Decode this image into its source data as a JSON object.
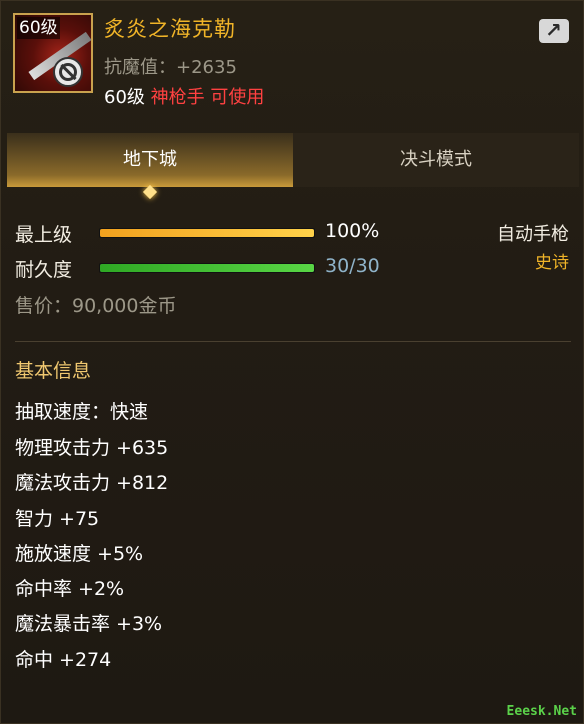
{
  "item": {
    "level_badge": "60级",
    "name": "炙炎之海克勒",
    "resist": "抗魔值：+2635",
    "req_level": "60级",
    "req_class": "神枪手 可使用"
  },
  "tabs": [
    {
      "label": "地下城",
      "active": true
    },
    {
      "label": "决斗模式",
      "active": false
    }
  ],
  "stats": {
    "upgrade_label": "最上级",
    "upgrade_value": "100%",
    "upgrade_fraction": 1.0,
    "durability_label": "耐久度",
    "durability_value": "30/30",
    "durability_fraction": 1.0,
    "weapon_type": "自动手枪",
    "rarity": "史诗",
    "price": "售价：90,000金币"
  },
  "section": {
    "title": "基本信息",
    "attributes": [
      "抽取速度：快速",
      "物理攻击力 +635",
      "魔法攻击力 +812",
      "智力 +75",
      "施放速度 +5%",
      "命中率 +2%",
      "魔法暴击率 +3%",
      "命中 +274"
    ]
  },
  "watermark": "Eeesk.Net",
  "colors": {
    "title": "#f0b428",
    "class_red": "#ff4141",
    "upgrade_bar": "#f2b41e",
    "durability_bar": "#3fbf2e",
    "durability_text": "#8fb3c9"
  },
  "icons": [
    "item-icon",
    "no-entry-icon",
    "share-icon"
  ]
}
